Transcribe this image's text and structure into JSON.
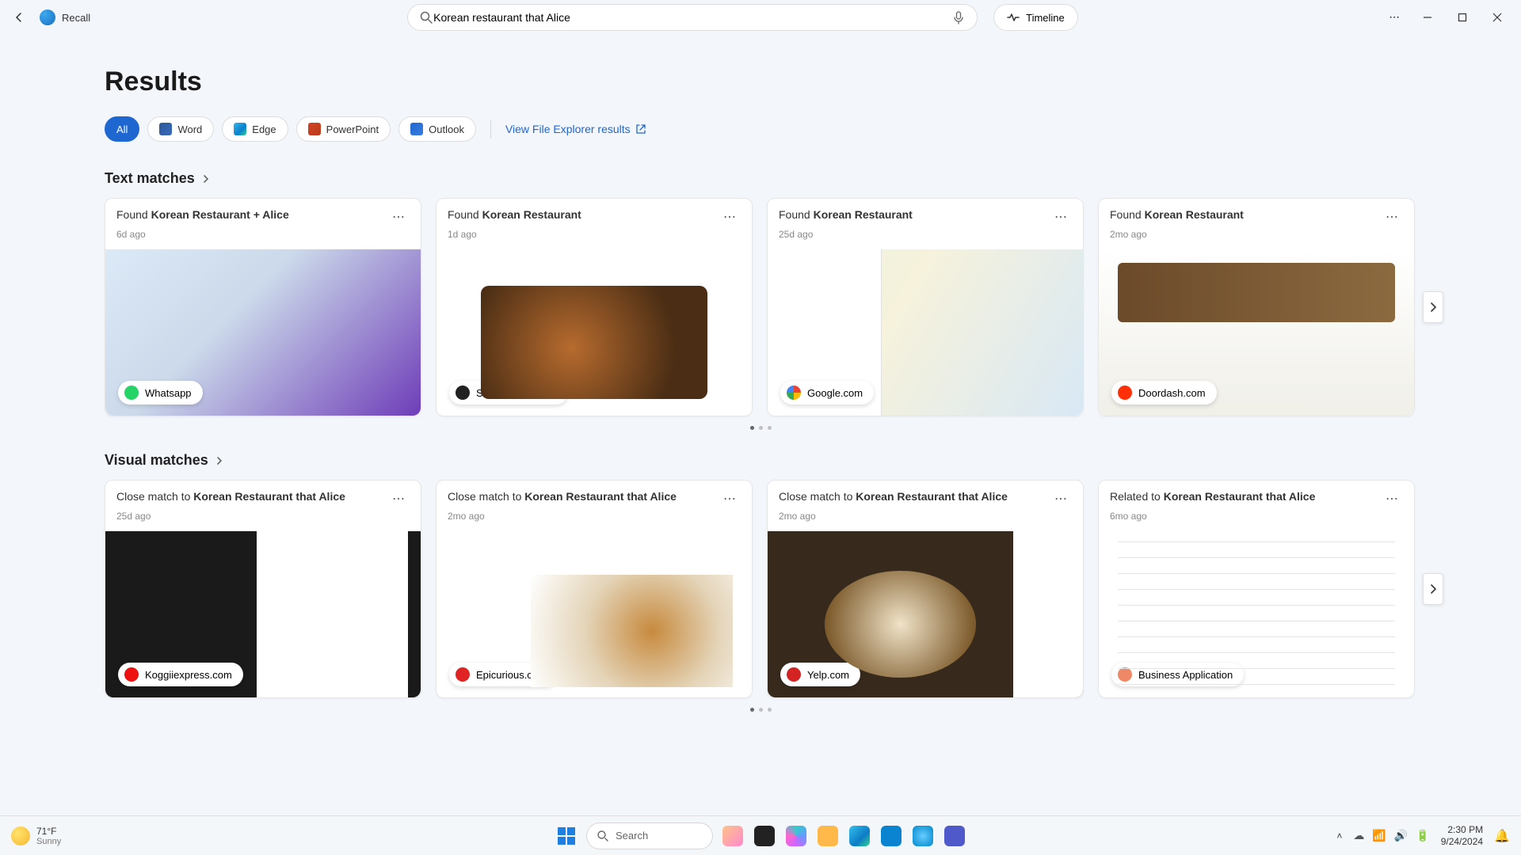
{
  "app": {
    "title": "Recall"
  },
  "search": {
    "value": "Korean restaurant that Alice"
  },
  "timeline_label": "Timeline",
  "page_heading": "Results",
  "filters": {
    "all": "All",
    "word": "Word",
    "edge": "Edge",
    "powerpoint": "PowerPoint",
    "outlook": "Outlook",
    "file_explorer_link": "View File Explorer results"
  },
  "sections": {
    "text_matches": "Text matches",
    "visual_matches": "Visual matches"
  },
  "text_cards": [
    {
      "prefix": "Found ",
      "bold": "Korean Restaurant + Alice",
      "sub": "6d ago",
      "badge": "Whatsapp"
    },
    {
      "prefix": "Found ",
      "bold": "Korean Restaurant",
      "sub": "1d ago",
      "badge": "Stonekorean.com"
    },
    {
      "prefix": "Found ",
      "bold": "Korean Restaurant",
      "sub": "25d ago",
      "badge": "Google.com"
    },
    {
      "prefix": "Found ",
      "bold": "Korean Restaurant",
      "sub": "2mo ago",
      "badge": "Doordash.com"
    }
  ],
  "visual_cards": [
    {
      "prefix": "Close match to ",
      "bold": "Korean Restaurant that Alice",
      "sub": "25d ago",
      "badge": "Koggiiexpress.com"
    },
    {
      "prefix": "Close match to ",
      "bold": "Korean Restaurant that Alice",
      "sub": "2mo ago",
      "badge": "Epicurious.com"
    },
    {
      "prefix": "Close match to ",
      "bold": "Korean Restaurant that Alice",
      "sub": "2mo ago",
      "badge": "Yelp.com"
    },
    {
      "prefix": "Related to ",
      "bold": "Korean Restaurant that Alice",
      "sub": "6mo ago",
      "badge": "Business Application"
    }
  ],
  "taskbar": {
    "weather_temp": "71°F",
    "weather_cond": "Sunny",
    "search_placeholder": "Search",
    "time": "2:30 PM",
    "date": "9/24/2024"
  }
}
